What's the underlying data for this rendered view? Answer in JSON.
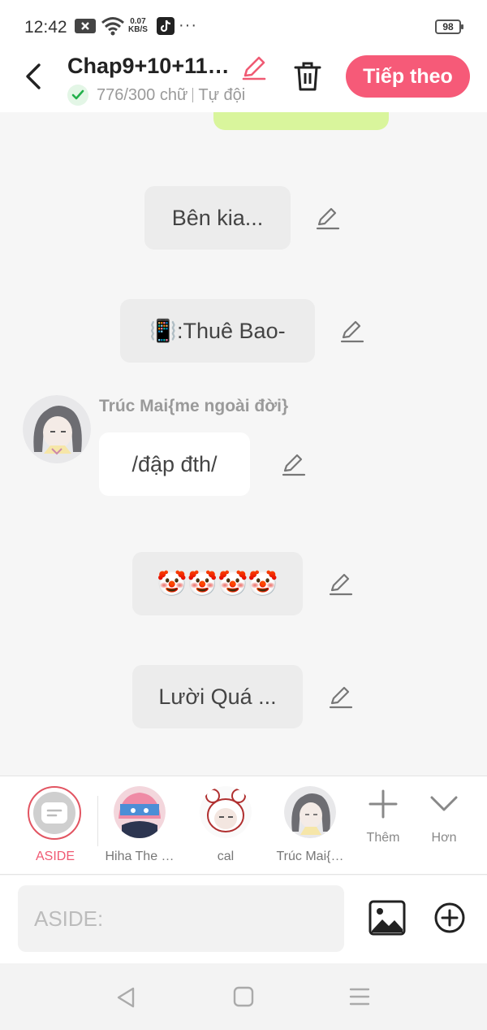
{
  "status_bar": {
    "time": "12:42",
    "net_speed_value": "0.07",
    "net_speed_unit": "KB/S",
    "more": "···",
    "battery": "98"
  },
  "header": {
    "title": "Chap9+10+11…",
    "word_count": "776/300 chữ",
    "mode": "Tự đội",
    "next_label": "Tiếp theo",
    "accent_color": "#f65a78"
  },
  "messages": [
    {
      "text": "Bên kia..."
    },
    {
      "text": "📳:Thuê Bao-"
    },
    {
      "speaker": "Trúc Mai{me ngoài đời}",
      "text": "/đập đth/"
    },
    {
      "text": "🤡🤡🤡🤡"
    },
    {
      "text": "Lười Quá ..."
    }
  ],
  "characters": {
    "aside_label": "ASIDE",
    "items": [
      {
        "label": "Hiha The …"
      },
      {
        "label": "cal"
      },
      {
        "label": "Trúc Mai{…"
      }
    ],
    "add_label": "Thêm",
    "more_label": "Hơn"
  },
  "input": {
    "placeholder": "ASIDE:"
  }
}
